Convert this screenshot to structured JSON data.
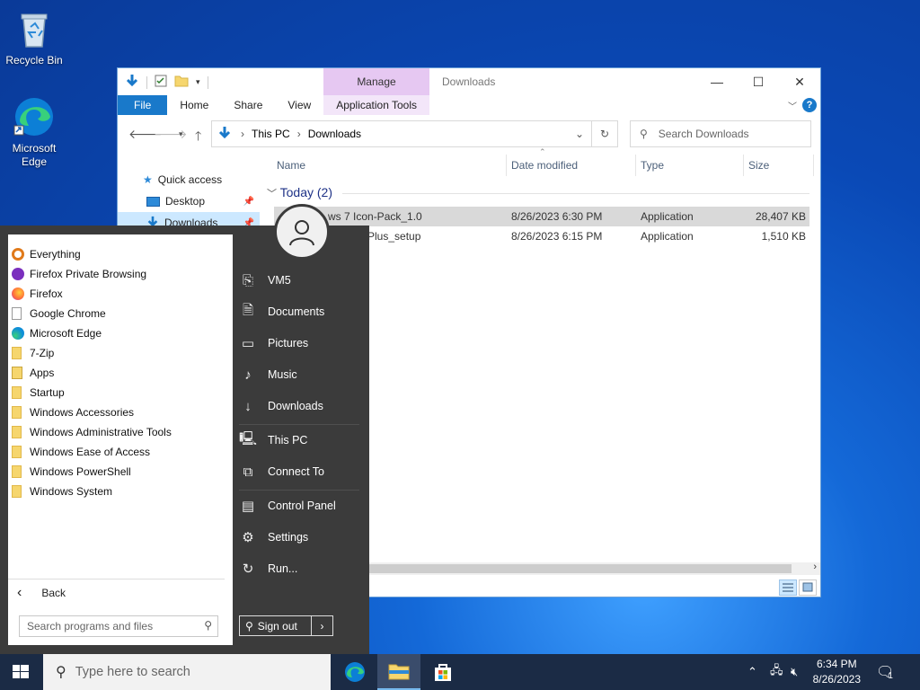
{
  "desktop": {
    "icons": [
      {
        "label": "Recycle Bin"
      },
      {
        "label": "Microsoft\nEdge"
      }
    ]
  },
  "explorer": {
    "manage_tab": "Manage",
    "title": "Downloads",
    "tabs": {
      "file": "File",
      "home": "Home",
      "share": "Share",
      "view": "View",
      "app_tools": "Application Tools"
    },
    "help": "?",
    "breadcrumb": [
      "This PC",
      "Downloads"
    ],
    "search_placeholder": "Search Downloads",
    "nav": {
      "quick_access": "Quick access",
      "desktop": "Desktop",
      "downloads": "Downloads"
    },
    "columns": {
      "name": "Name",
      "date": "Date modified",
      "type": "Type",
      "size": "Size"
    },
    "group": "Today (2)",
    "files": [
      {
        "name": "ws 7 Icon-Pack_1.0",
        "date": "8/26/2023 6:30 PM",
        "type": "Application",
        "size": "28,407 KB"
      },
      {
        "name": "Plus_setup",
        "date": "8/26/2023 6:15 PM",
        "type": "Application",
        "size": "1,510 KB"
      }
    ]
  },
  "startmenu": {
    "programs": [
      {
        "label": "Everything",
        "icon": "everything-icon",
        "color": "#e07a1b"
      },
      {
        "label": "Firefox Private Browsing",
        "icon": "firefox-private-icon",
        "color": "#7b2fbe"
      },
      {
        "label": "Firefox",
        "icon": "firefox-icon",
        "color": "#ff7139"
      },
      {
        "label": "Google Chrome",
        "icon": "blank-file-icon",
        "color": "#ffffff"
      },
      {
        "label": "Microsoft Edge",
        "icon": "edge-icon",
        "color": "#0f8fd8"
      },
      {
        "label": "7-Zip",
        "icon": "folder-icon",
        "color": "#f6d66e"
      },
      {
        "label": "Apps",
        "icon": "apps-icon",
        "color": "#f6d66e"
      },
      {
        "label": "Startup",
        "icon": "folder-icon",
        "color": "#f6d66e"
      },
      {
        "label": "Windows Accessories",
        "icon": "folder-icon",
        "color": "#f6d66e"
      },
      {
        "label": "Windows Administrative Tools",
        "icon": "folder-icon",
        "color": "#f6d66e"
      },
      {
        "label": "Windows Ease of Access",
        "icon": "folder-icon",
        "color": "#f6d66e"
      },
      {
        "label": "Windows PowerShell",
        "icon": "folder-icon",
        "color": "#f6d66e"
      },
      {
        "label": "Windows System",
        "icon": "folder-icon",
        "color": "#f6d66e"
      }
    ],
    "back": "Back",
    "search_placeholder": "Search programs and files",
    "right": {
      "user": "VM5",
      "documents": "Documents",
      "pictures": "Pictures",
      "music": "Music",
      "downloads": "Downloads",
      "this_pc": "This PC",
      "connect_to": "Connect To",
      "control_panel": "Control Panel",
      "settings": "Settings",
      "run": "Run..."
    },
    "sign_out": "Sign out"
  },
  "taskbar": {
    "search_placeholder": "Type here to search",
    "time": "6:34 PM",
    "date": "8/26/2023",
    "notifications": "1"
  }
}
